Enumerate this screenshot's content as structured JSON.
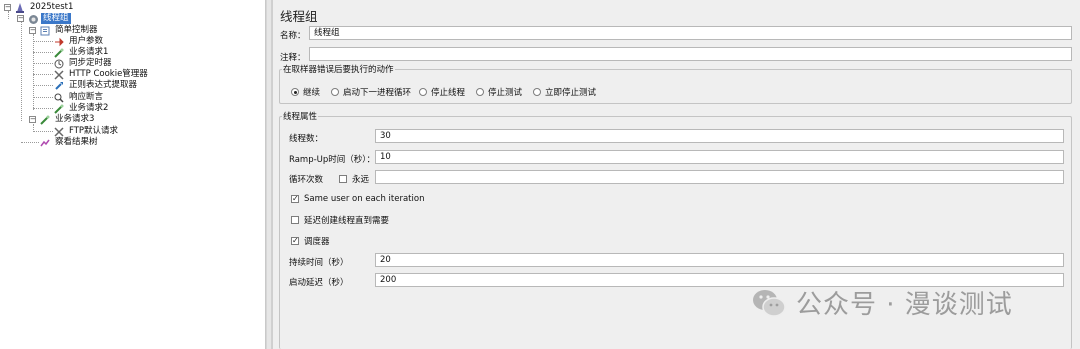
{
  "tree": {
    "root": "2025test1",
    "thread_group": "线程组",
    "controller": "简单控制器",
    "children": [
      "用户参数",
      "业务请求1",
      "同步定时器",
      "HTTP Cookie管理器",
      "正则表达式提取器",
      "响应断言",
      "业务请求2"
    ],
    "request3": "业务请求3",
    "ftp_defaults": "FTP默认请求",
    "results_tree": "察看结果树"
  },
  "panel": {
    "title": "线程组",
    "name_label": "名称：",
    "name_value": "线程组",
    "comment_label": "注释：",
    "comment_value": "",
    "error_action": {
      "legend": "在取样器错误后要执行的动作",
      "options": [
        "继续",
        "启动下一进程循环",
        "停止线程",
        "停止测试",
        "立即停止测试"
      ],
      "selected": "继续"
    },
    "thread_props": {
      "legend": "线程属性",
      "threads_label": "线程数：",
      "threads_value": "30",
      "rampup_label": "Ramp-Up时间（秒）：",
      "rampup_value": "10",
      "loop_label": "循环次数",
      "forever_label": "永远",
      "forever_checked": false,
      "loop_value": "",
      "same_user_label": "Same user on each iteration",
      "same_user_checked": true,
      "delay_create_label": "延迟创建线程直到需要",
      "delay_create_checked": false,
      "scheduler_label": "调度器",
      "scheduler_checked": true,
      "duration_label": "持续时间（秒）",
      "duration_value": "20",
      "startup_delay_label": "启动延迟（秒）",
      "startup_delay_value": "200"
    }
  },
  "watermark": {
    "text": "公众号 · 漫谈测试",
    "icon": "wechat-icon"
  },
  "colors": {
    "selection": "#3b78c9",
    "panel_bg": "#efefef",
    "tree_bg": "#ffffff"
  }
}
